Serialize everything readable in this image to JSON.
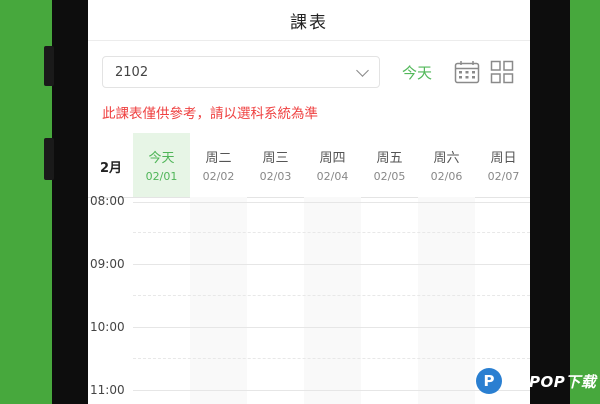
{
  "header": {
    "title": "課表"
  },
  "toolbar": {
    "class_value": "2102",
    "today_label": "今天",
    "calendar_icon": "calendar-icon",
    "grid_icon": "grid-view-icon"
  },
  "notice": "此課表僅供參考，請以選科系統為準",
  "schedule": {
    "month": "2月",
    "days": [
      {
        "name": "今天",
        "date": "02/01",
        "today": true
      },
      {
        "name": "周二",
        "date": "02/02"
      },
      {
        "name": "周三",
        "date": "02/03"
      },
      {
        "name": "周四",
        "date": "02/04"
      },
      {
        "name": "周五",
        "date": "02/05"
      },
      {
        "name": "周六",
        "date": "02/06"
      },
      {
        "name": "周日",
        "date": "02/07"
      }
    ],
    "times": [
      "08:00",
      "09:00",
      "10:00",
      "11:00"
    ]
  },
  "watermark": {
    "text": "PCPOP下载"
  },
  "colors": {
    "accent": "#52b85a",
    "notice": "#ef4141",
    "background": "#47a83d"
  }
}
